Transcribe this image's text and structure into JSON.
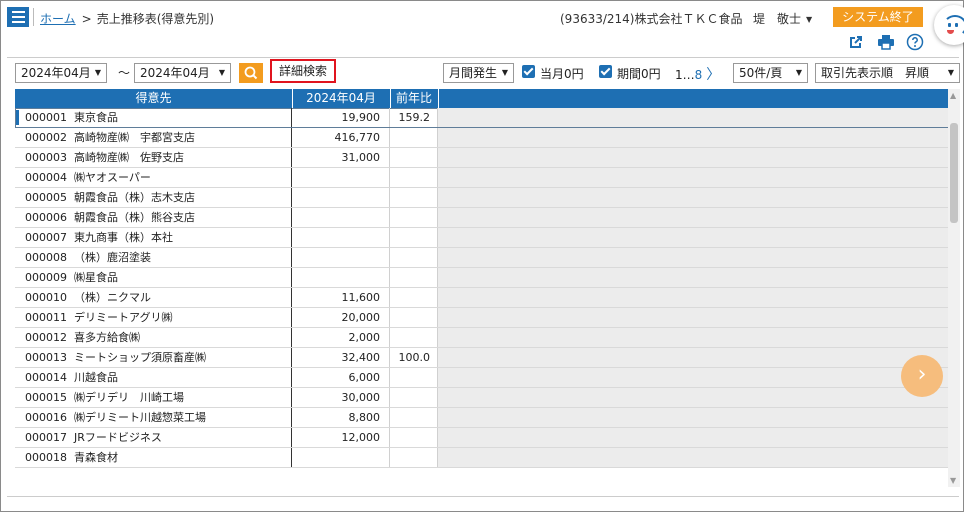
{
  "header": {
    "breadcrumb_home": "ホーム",
    "breadcrumb_sep": ">",
    "breadcrumb_current": "売上推移表(得意先別)",
    "company": "(93633/214)株式会社ＴＫＣ食品",
    "user": "堤　敬士",
    "exit_label": "システム終了"
  },
  "toolbar": {
    "from_month": "2024年04月",
    "tilde": "～",
    "to_month": "2024年04月",
    "detail_search": "詳細検索",
    "aggregation": "月間発生",
    "current_month_zero": "当月0円",
    "period_zero": "期間0円",
    "page_current": "1",
    "page_ellipsis": "…",
    "page_last": "8",
    "page_next": "〉",
    "per_page": "50件/頁",
    "sort": "取引先表示順　昇順"
  },
  "table": {
    "headers": [
      "得意先",
      "2024年04月",
      "前年比"
    ],
    "rows": [
      {
        "code": "000001",
        "name": "東京食品",
        "amount": "19,900",
        "ratio": "159.2"
      },
      {
        "code": "000002",
        "name": "高崎物産㈱　宇都宮支店",
        "amount": "416,770",
        "ratio": ""
      },
      {
        "code": "000003",
        "name": "高崎物産㈱　佐野支店",
        "amount": "31,000",
        "ratio": ""
      },
      {
        "code": "000004",
        "name": "㈱ヤオスーパー",
        "amount": "",
        "ratio": ""
      },
      {
        "code": "000005",
        "name": "朝霞食品（株）志木支店",
        "amount": "",
        "ratio": ""
      },
      {
        "code": "000006",
        "name": "朝霞食品（株）熊谷支店",
        "amount": "",
        "ratio": ""
      },
      {
        "code": "000007",
        "name": "東九商事（株）本社",
        "amount": "",
        "ratio": ""
      },
      {
        "code": "000008",
        "name": "（株）鹿沼塗装",
        "amount": "",
        "ratio": ""
      },
      {
        "code": "000009",
        "name": "㈱星食品",
        "amount": "",
        "ratio": ""
      },
      {
        "code": "000010",
        "name": "（株）ニクマル",
        "amount": "11,600",
        "ratio": ""
      },
      {
        "code": "000011",
        "name": "デリミートアグリ㈱",
        "amount": "20,000",
        "ratio": ""
      },
      {
        "code": "000012",
        "name": "喜多方給食㈱",
        "amount": "2,000",
        "ratio": ""
      },
      {
        "code": "000013",
        "name": "ミートショップ須原畜産㈱",
        "amount": "32,400",
        "ratio": "100.0"
      },
      {
        "code": "000014",
        "name": "川越食品",
        "amount": "6,000",
        "ratio": ""
      },
      {
        "code": "000015",
        "name": "㈱デリデリ　川崎工場",
        "amount": "30,000",
        "ratio": ""
      },
      {
        "code": "000016",
        "name": "㈱デリミート川越惣菜工場",
        "amount": "8,800",
        "ratio": ""
      },
      {
        "code": "000017",
        "name": "JRフードビジネス",
        "amount": "12,000",
        "ratio": ""
      },
      {
        "code": "000018",
        "name": "青森食材",
        "amount": "",
        "ratio": ""
      }
    ]
  },
  "colors": {
    "accent_blue": "#1e6fb3",
    "accent_orange": "#f39c1f",
    "highlight_red": "#e0141e"
  },
  "icons": [
    "menu-icon",
    "search-icon",
    "export-icon",
    "print-icon",
    "help-icon",
    "next-page-icon",
    "mascot-icon"
  ]
}
